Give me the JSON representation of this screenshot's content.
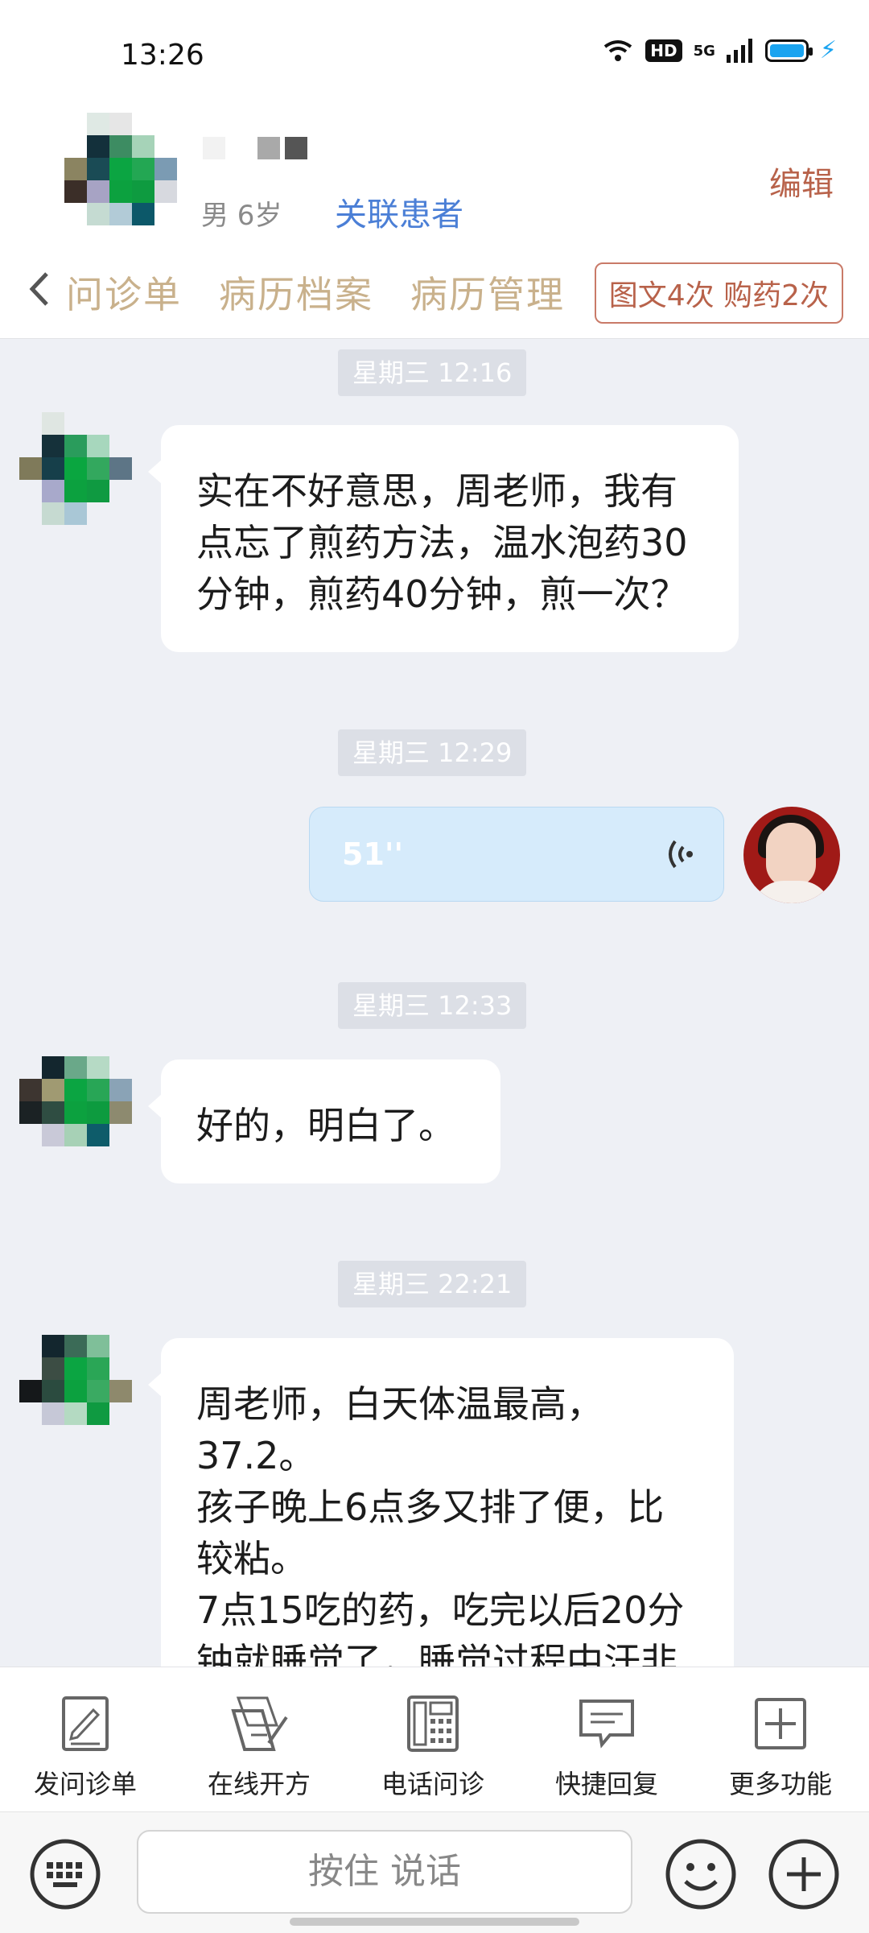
{
  "status_bar": {
    "time": "13:26",
    "hd": "HD",
    "network": "5G"
  },
  "header": {
    "patient_meta": "男 6岁",
    "link_label": "关联患者",
    "edit_label": "编辑",
    "tabs": [
      "问诊单",
      "病历档案",
      "病历管理"
    ],
    "usage_badge": "图文4次 购药2次"
  },
  "chat": {
    "messages": [
      {
        "timestamp": "星期三 12:16",
        "text": "实在不好意思，周老师，我有点忘了煎药方法，温水泡药30分钟，煎药40分钟，煎一次？"
      },
      {
        "timestamp": "星期三 12:29",
        "voice_duration": "51''"
      },
      {
        "timestamp": "星期三 12:33",
        "text": "好的，明白了。"
      },
      {
        "timestamp": "星期三 22:21",
        "text": "周老师，白天体温最高，\n37.2。\n孩子晚上6点多又排了便，比较粘。\n7点15吃的药，吃完以后20分钟就睡觉了，睡觉过程中汗非"
      }
    ]
  },
  "toolbar": {
    "items": [
      {
        "label": "发问诊单",
        "icon": "form-edit-icon"
      },
      {
        "label": "在线开方",
        "icon": "prescription-icon"
      },
      {
        "label": "电话问诊",
        "icon": "phone-icon"
      },
      {
        "label": "快捷回复",
        "icon": "quick-reply-icon"
      },
      {
        "label": "更多功能",
        "icon": "more-plus-icon"
      }
    ]
  },
  "input_bar": {
    "hold_to_talk": "按住 说话"
  }
}
